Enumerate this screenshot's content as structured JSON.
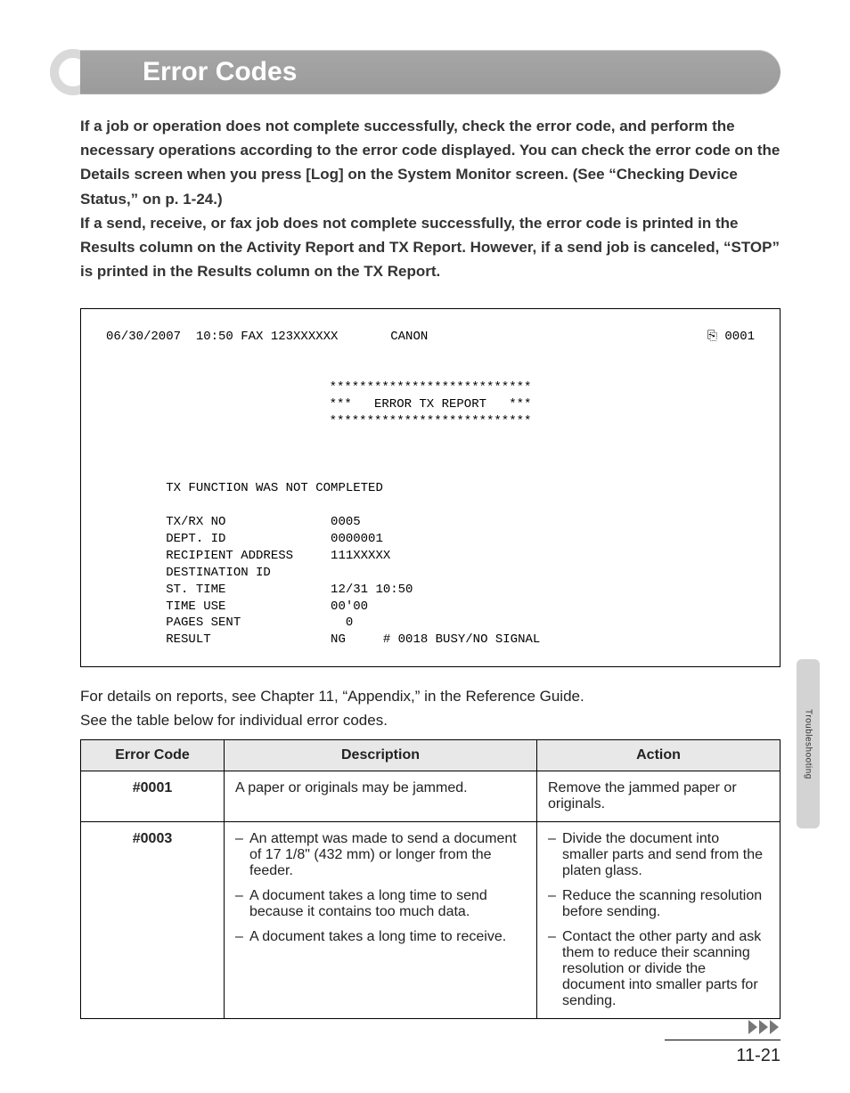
{
  "heading": {
    "title": "Error Codes"
  },
  "intro": {
    "text": "If a job or operation does not complete successfully, check the error code, and perform the necessary operations according to the error code displayed. You can check the error code on the Details screen when you press [Log] on the System Monitor screen. (See “Checking Device Status,” on p. 1-24.)\nIf a send, receive, or fax job does not complete successfully, the error code is printed in the Results column on the Activity Report and TX Report. However, if a send job is canceled, “STOP” is printed in the Results column on the TX Report."
  },
  "report": {
    "top_left": "06/30/2007  10:50 FAX 123XXXXXX       CANON",
    "top_right_icon": "⎘",
    "top_right": "0001",
    "stars_line": "***************************",
    "title_line": "***   ERROR TX REPORT   ***",
    "status_line": "TX FUNCTION WAS NOT COMPLETED",
    "rows": [
      {
        "label": "TX/RX NO",
        "value": "0005"
      },
      {
        "label": "DEPT. ID",
        "value": "0000001"
      },
      {
        "label": "RECIPIENT ADDRESS",
        "value": "111XXXXX"
      },
      {
        "label": "DESTINATION ID",
        "value": ""
      },
      {
        "label": "ST. TIME",
        "value": "12/31 10:50"
      },
      {
        "label": "TIME USE",
        "value": "00'00"
      },
      {
        "label": "PAGES SENT",
        "value": "  0"
      },
      {
        "label": "RESULT",
        "value": "NG     # 0018 BUSY/NO SIGNAL"
      }
    ]
  },
  "caption": {
    "line1": "For details on reports, see Chapter 11, “Appendix,” in the Reference Guide.",
    "line2": "See the table below for individual error codes."
  },
  "table": {
    "headers": {
      "code": "Error Code",
      "desc": "Description",
      "action": "Action"
    },
    "rows": [
      {
        "code": "#0001",
        "desc_plain": "A paper or originals may be jammed.",
        "action_plain": "Remove the jammed paper or originals."
      },
      {
        "code": "#0003",
        "desc_list": [
          "An attempt was made to send a document of 17 1/8\" (432 mm) or longer from the feeder.",
          "A document takes a long time to send because it contains too much data.",
          "A document takes a long time to receive."
        ],
        "action_list": [
          "Divide the document into smaller parts and send from the platen glass.",
          "Reduce the scanning resolution before sending.",
          "Contact the other party and ask them to reduce their scanning resolution or divide the document into smaller parts for sending."
        ]
      }
    ]
  },
  "side_tab": {
    "label": "Troubleshooting"
  },
  "footer": {
    "page": "11-21"
  }
}
